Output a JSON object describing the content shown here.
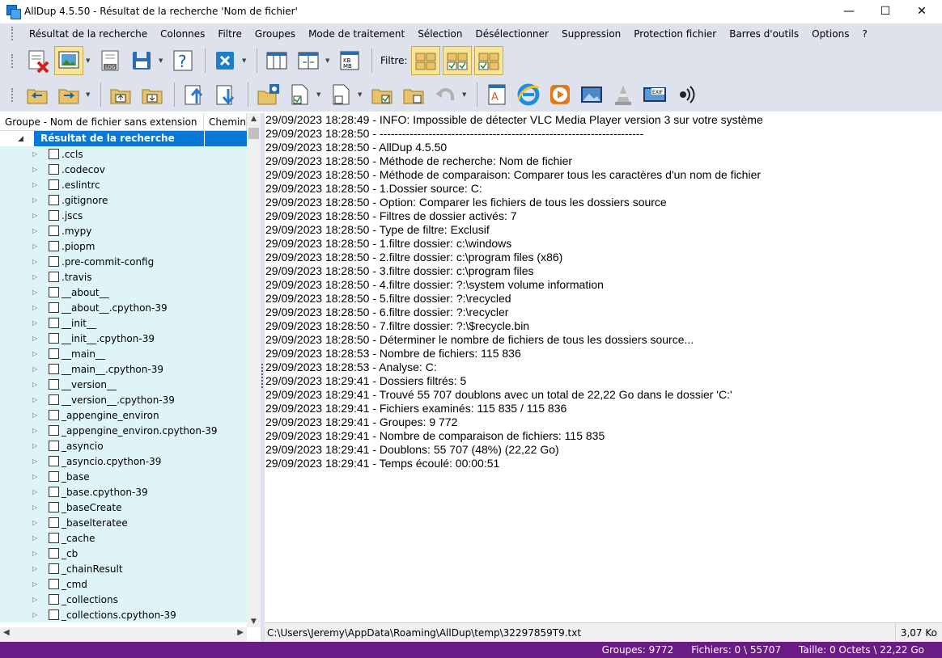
{
  "window": {
    "title": "AllDup 4.5.50 - Résultat de la recherche 'Nom de fichier'",
    "minimize": "—",
    "maximize": "☐",
    "close": "✕"
  },
  "menu": [
    "Résultat de la recherche",
    "Colonnes",
    "Filtre",
    "Groupes",
    "Mode de traitement",
    "Sélection",
    "Désélectionner",
    "Suppression",
    "Protection fichier",
    "Barres d'outils",
    "Options",
    "?"
  ],
  "toolbar": {
    "filter_label": "Filtre:",
    "log_label": "LOG",
    "kbmb_label": "KB MB",
    "exif_label": "EXIF"
  },
  "tree": {
    "col_group": "Groupe - Nom de fichier sans extension",
    "col_path": "Chemin",
    "root": "Résultat de la recherche",
    "items": [
      ".ccls",
      ".codecov",
      ".eslintrc",
      ".gitignore",
      ".jscs",
      ".mypy",
      ".piopm",
      ".pre-commit-config",
      ".travis",
      "__about__",
      "__about__.cpython-39",
      "__init__",
      "__init__.cpython-39",
      "__main__",
      "__main__.cpython-39",
      "__version__",
      "__version__.cpython-39",
      "_appengine_environ",
      "_appengine_environ.cpython-39",
      "_asyncio",
      "_asyncio.cpython-39",
      "_base",
      "_base.cpython-39",
      "_baseCreate",
      "_baselteratee",
      "_cache",
      "_cb",
      "_chainResult",
      "_cmd",
      "_collections",
      "_collections.cpython-39"
    ]
  },
  "log": [
    "29/09/2023 18:28:49 - INFO: Impossible de détecter VLC Media Player version 3 sur votre système",
    "29/09/2023 18:28:50 - ----------------------------------------------------------------------",
    "29/09/2023 18:28:50 - AllDup 4.5.50",
    "29/09/2023 18:28:50 - Méthode de recherche: Nom de fichier",
    "29/09/2023 18:28:50 - Méthode de comparaison: Comparer tous les caractères d'un nom de fichier",
    "29/09/2023 18:28:50 - 1.Dossier source: C:",
    "29/09/2023 18:28:50 - Option: Comparer les fichiers de tous les dossiers source",
    "29/09/2023 18:28:50 - Filtres de dossier activés: 7",
    "29/09/2023 18:28:50 - Type de filtre: Exclusif",
    "29/09/2023 18:28:50 - 1.filtre dossier: c:\\windows",
    "29/09/2023 18:28:50 - 2.filtre dossier: c:\\program files (x86)",
    "29/09/2023 18:28:50 - 3.filtre dossier: c:\\program files",
    "29/09/2023 18:28:50 - 4.filtre dossier: ?:\\system volume information",
    "29/09/2023 18:28:50 - 5.filtre dossier: ?:\\recycled",
    "29/09/2023 18:28:50 - 6.filtre dossier: ?:\\recycler",
    "29/09/2023 18:28:50 - 7.filtre dossier: ?:\\$recycle.bin",
    "29/09/2023 18:28:50 - Déterminer le nombre de fichiers de tous les dossiers source...",
    "29/09/2023 18:28:53 - Nombre de fichiers: 115 836",
    "29/09/2023 18:28:53 - Analyse: C:",
    "29/09/2023 18:29:41 - Dossiers filtrés: 5",
    "29/09/2023 18:29:41 - Trouvé 55 707 doublons avec un total de 22,22 Go dans le dossier 'C:'",
    "29/09/2023 18:29:41 - Fichiers examinés: 115 835 / 115 836",
    "29/09/2023 18:29:41 - Groupes: 9 772",
    "29/09/2023 18:29:41 - Nombre de comparaison de fichiers: 115 835",
    "29/09/2023 18:29:41 - Doublons: 55 707 (48%) (22,22 Go)",
    "29/09/2023 18:29:41 - Temps écoulé: 00:00:51"
  ],
  "path_bar": {
    "path": "C:\\Users\\Jeremy\\AppData\\Roaming\\AllDup\\temp\\32297859T9.txt",
    "size": "3,07 Ko"
  },
  "status": {
    "groups": "Groupes: 9772",
    "files": "Fichiers: 0 \\ 55707",
    "size": "Taille: 0 Octets \\ 22,22 Go"
  },
  "colors": {
    "toolbar_bg": "#dde2ec",
    "status_bg": "#6a1b84",
    "tree_row_bg": "#dff4f6",
    "selection": "#0a78d7"
  }
}
